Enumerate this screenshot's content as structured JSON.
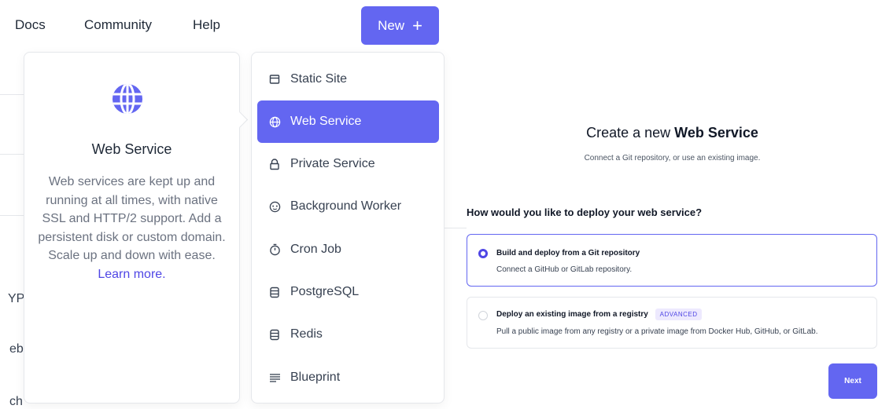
{
  "nav": {
    "docs": "Docs",
    "community": "Community",
    "help": "Help",
    "new_button": "New",
    "new_icon": "+"
  },
  "background_fragments": {
    "frag1": "YPI",
    "frag2": "eb",
    "frag3": "ch"
  },
  "description": {
    "icon": "globe-icon",
    "title": "Web Service",
    "text": "Web services are kept up and running at all times, with native SSL and HTTP/2 support. Add a persistent disk or custom domain. Scale up and down with ease.",
    "link": "Learn more."
  },
  "menu": {
    "items": [
      {
        "label": "Static Site",
        "icon": "static-site-icon"
      },
      {
        "label": "Web Service",
        "icon": "globe-icon",
        "active": true
      },
      {
        "label": "Private Service",
        "icon": "lock-icon"
      },
      {
        "label": "Background Worker",
        "icon": "worker-icon"
      },
      {
        "label": "Cron Job",
        "icon": "stopwatch-icon"
      },
      {
        "label": "PostgreSQL",
        "icon": "database-icon"
      },
      {
        "label": "Redis",
        "icon": "database-icon"
      },
      {
        "label": "Blueprint",
        "icon": "blueprint-icon"
      }
    ]
  },
  "create": {
    "title_prefix": "Create a new",
    "title_bold": "Web Service",
    "subtitle": "Connect a Git repository, or use an existing image.",
    "question": "How would you like to deploy your web service?",
    "options": [
      {
        "title": "Build and deploy from a Git repository",
        "desc": "Connect a GitHub or GitLab repository.",
        "selected": true
      },
      {
        "title": "Deploy an existing image from a registry",
        "badge": "ADVANCED",
        "desc": "Pull a public image from any registry or a private image from Docker Hub, GitHub, or GitLab.",
        "selected": false
      }
    ],
    "next_button": "Next"
  },
  "colors": {
    "accent": "#6366f1",
    "text_muted": "#6b7280",
    "link": "#4f46e5"
  }
}
